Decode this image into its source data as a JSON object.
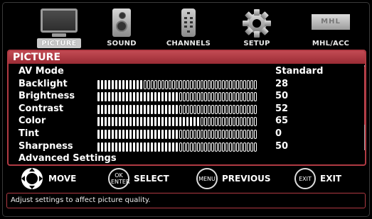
{
  "tabs": [
    {
      "label": "PICTURE",
      "icon": "monitor-icon",
      "active": true
    },
    {
      "label": "SOUND",
      "icon": "speaker-icon"
    },
    {
      "label": "CHANNELS",
      "icon": "remote-icon"
    },
    {
      "label": "SETUP",
      "icon": "gear-icon"
    },
    {
      "label": "MHL/ACC",
      "icon": "mhl-icon",
      "logo_text": "MHL"
    }
  ],
  "panel": {
    "title": "PICTURE",
    "rows": [
      {
        "name": "AV Mode",
        "value": "Standard"
      },
      {
        "name": "Backlight",
        "value": "28",
        "level": 28
      },
      {
        "name": "Brightness",
        "value": "50",
        "level": 50
      },
      {
        "name": "Contrast",
        "value": "52",
        "level": 52
      },
      {
        "name": "Color",
        "value": "65",
        "level": 65
      },
      {
        "name": "Tint",
        "value": "0",
        "level": 50
      },
      {
        "name": "Sharpness",
        "value": "50",
        "level": 50
      },
      {
        "name": "Advanced Settings",
        "value": ""
      }
    ]
  },
  "hints": [
    {
      "button": "",
      "label": "MOVE",
      "icon": "dpad-icon"
    },
    {
      "button": "OK ENTER",
      "label": "SELECT"
    },
    {
      "button": "MENU",
      "label": "PREVIOUS"
    },
    {
      "button": "EXIT",
      "label": "EXIT"
    }
  ],
  "status": "Adjust settings to affect picture quality.",
  "colors": {
    "accent": "#b03a43",
    "header": "#c24a53",
    "background": "#000000"
  }
}
